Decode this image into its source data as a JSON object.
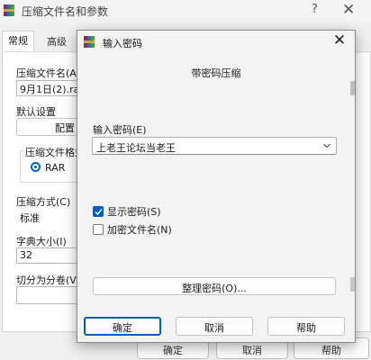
{
  "background_dialog": {
    "title": "压缩文件名和参数",
    "help_glyph": "?",
    "close_glyph": "✕",
    "tabs": [
      {
        "label": "常规",
        "active": true
      },
      {
        "label": "高级",
        "active": false
      }
    ],
    "archive_name_label": "压缩文件名(A)",
    "archive_name_value": "9月1日(2).rar",
    "default_settings_label": "默认设置",
    "profiles_button": "配置",
    "archive_format_label": "压缩文件格式",
    "format_rar": "RAR",
    "compression_method_label": "压缩方式(C)",
    "compression_method_value": "标准",
    "dictionary_size_label": "字典大小(I)",
    "dictionary_size_value": "32",
    "split_volumes_label": "切分为分卷(V)",
    "bottom_buttons": [
      "确定",
      "取消",
      "帮助"
    ]
  },
  "password_dialog": {
    "title": "输入密码",
    "close_glyph": "✕",
    "heading": "带密码压缩",
    "password_label": "输入密码(E)",
    "password_value": "上老王论坛当老王",
    "show_password_label": "显示密码(S)",
    "show_password_checked": true,
    "encrypt_filenames_label": "加密文件名(N)",
    "encrypt_filenames_checked": false,
    "organize_button": "整理密码(O)...",
    "ok_button": "确定",
    "cancel_button": "取消",
    "help_button": "帮助"
  },
  "colors": {
    "accent": "#005fb8",
    "winrar_red": "#c0392b"
  }
}
